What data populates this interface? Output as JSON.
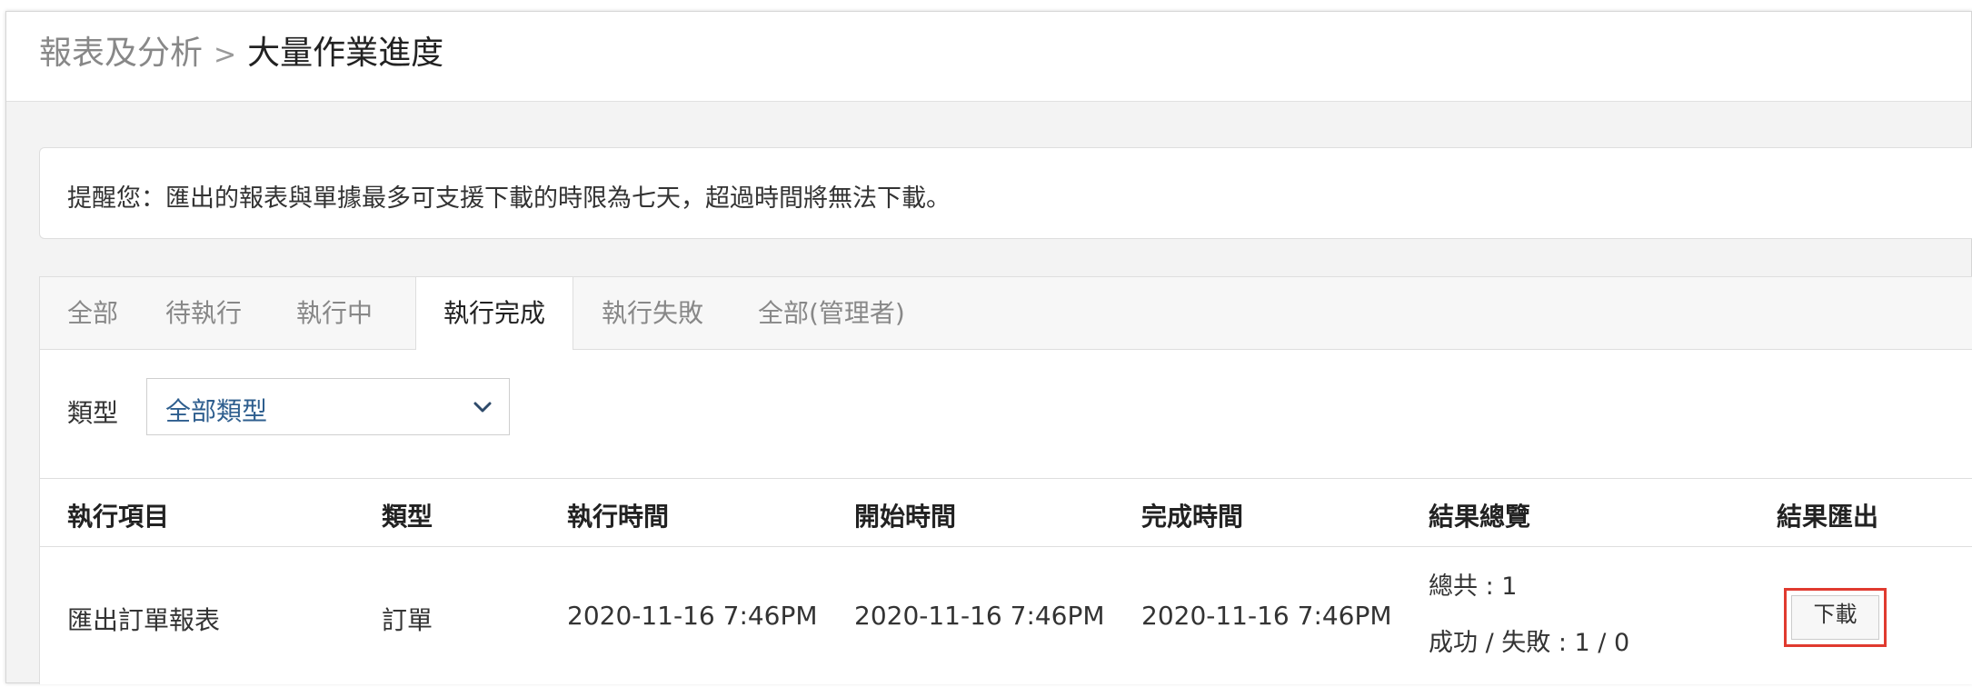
{
  "breadcrumb": {
    "parent": "報表及分析",
    "separator": ">",
    "current": "大量作業進度"
  },
  "notice": {
    "text": "提醒您：匯出的報表與單據最多可支援下載的時限為七天，超過時間將無法下載。"
  },
  "tabs": [
    {
      "label": "全部"
    },
    {
      "label": "待執行"
    },
    {
      "label": "執行中"
    },
    {
      "label": "執行完成",
      "active": true
    },
    {
      "label": "執行失敗"
    },
    {
      "label": "全部(管理者)"
    }
  ],
  "filter": {
    "label": "類型",
    "selected": "全部類型",
    "icon": "chevron-down-icon"
  },
  "table": {
    "headers": [
      "執行項目",
      "類型",
      "執行時間",
      "開始時間",
      "完成時間",
      "結果總覽",
      "結果匯出"
    ],
    "rows": [
      {
        "item": "匯出訂單報表",
        "type": "訂單",
        "exec_time": "2020-11-16 7:46PM",
        "start_time": "2020-11-16 7:46PM",
        "finish_time": "2020-11-16 7:46PM",
        "summary_total": "總共 : 1",
        "summary_success_fail": "成功 / 失敗 : 1 / 0",
        "action_label": "下載"
      }
    ]
  },
  "colors": {
    "highlight": "#e03a2f",
    "select_text": "#2e5e8e"
  }
}
